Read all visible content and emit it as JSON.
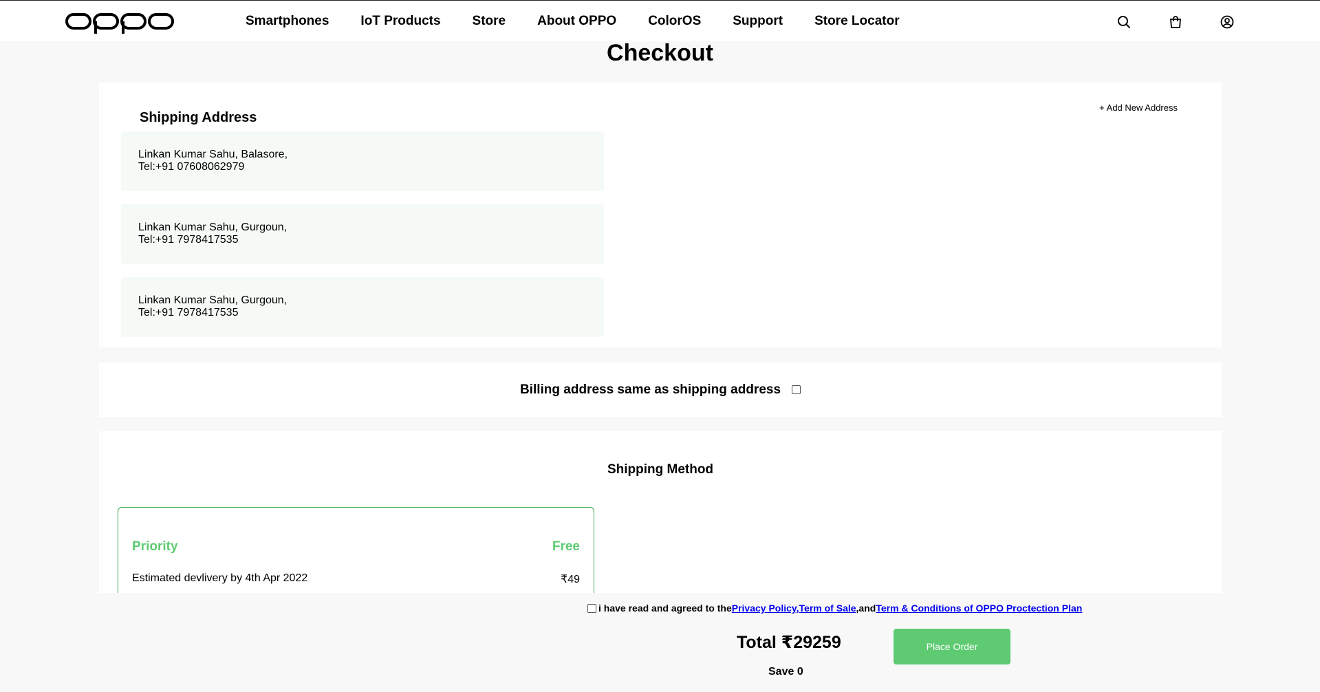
{
  "header": {
    "logo_alt": "OPPO",
    "nav": [
      "Smartphones",
      "IoT Products",
      "Store",
      "About OPPO",
      "ColorOS",
      "Support",
      "Store Locator"
    ],
    "icons": [
      "search-icon",
      "cart-icon",
      "account-icon"
    ]
  },
  "page": {
    "title": "Checkout"
  },
  "shipping": {
    "title": "Shipping Address",
    "add_label": "+ Add New Address",
    "addresses": [
      {
        "line1": "Linkan Kumar Sahu, Balasore,",
        "line2": "Tel:+91 07608062979"
      },
      {
        "line1": "Linkan Kumar Sahu, Gurgoun,",
        "line2": "Tel:+91 7978417535"
      },
      {
        "line1": "Linkan Kumar Sahu, Gurgoun,",
        "line2": "Tel:+91 7978417535"
      }
    ]
  },
  "billing": {
    "label": "Billing address same as shipping address",
    "checked": false
  },
  "method": {
    "title": "Shipping Method",
    "option": {
      "name": "Priority",
      "price": "Free",
      "estimate": "Estimated devlivery by 4th Apr 2022",
      "fee": "₹49"
    }
  },
  "footer": {
    "agree_prefix": "i have read and agreed to the ",
    "privacy": "Privacy Policy,",
    "terms": "Term of Sale",
    "and": ",and ",
    "plan": "Term & Conditions of OPPO Proctection Plan",
    "total": "Total ₹29259",
    "save": "Save 0",
    "place_order": "Place Order"
  },
  "colors": {
    "accent_green": "#5ecb72",
    "border_green": "#35a84d",
    "link_blue": "#0000ee"
  }
}
